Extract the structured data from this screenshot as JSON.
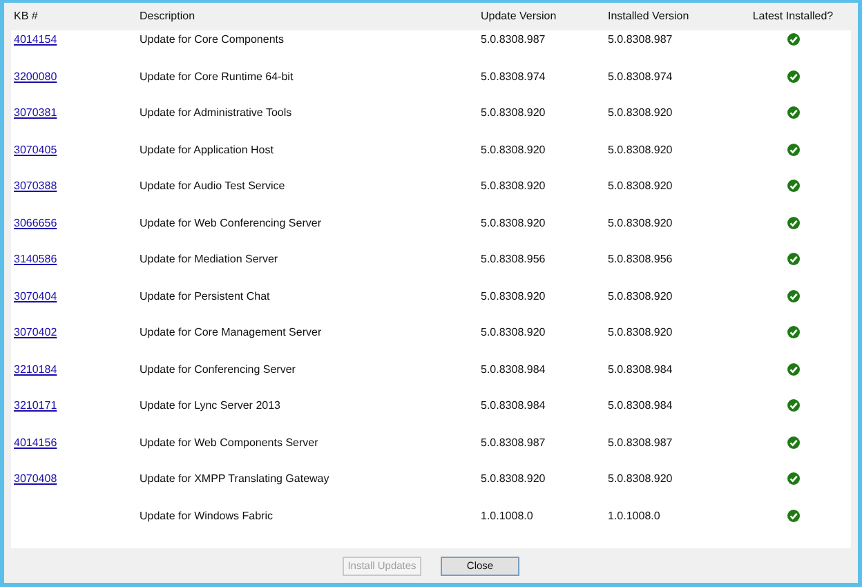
{
  "table": {
    "columns": [
      "KB #",
      "Description",
      "Update Version",
      "Installed Version",
      "Latest Installed?"
    ],
    "rows": [
      {
        "kb": "4014154",
        "description": "Update for Core Components",
        "update_version": "5.0.8308.987",
        "installed_version": "5.0.8308.987",
        "latest_installed": true
      },
      {
        "kb": "3200080",
        "description": "Update for Core Runtime 64-bit",
        "update_version": "5.0.8308.974",
        "installed_version": "5.0.8308.974",
        "latest_installed": true
      },
      {
        "kb": "3070381",
        "description": "Update for Administrative Tools",
        "update_version": "5.0.8308.920",
        "installed_version": "5.0.8308.920",
        "latest_installed": true
      },
      {
        "kb": "3070405",
        "description": "Update for Application Host",
        "update_version": "5.0.8308.920",
        "installed_version": "5.0.8308.920",
        "latest_installed": true
      },
      {
        "kb": "3070388",
        "description": "Update for Audio Test Service",
        "update_version": "5.0.8308.920",
        "installed_version": "5.0.8308.920",
        "latest_installed": true
      },
      {
        "kb": "3066656",
        "description": "Update for Web Conferencing Server",
        "update_version": "5.0.8308.920",
        "installed_version": "5.0.8308.920",
        "latest_installed": true
      },
      {
        "kb": "3140586",
        "description": "Update for Mediation Server",
        "update_version": "5.0.8308.956",
        "installed_version": "5.0.8308.956",
        "latest_installed": true
      },
      {
        "kb": "3070404",
        "description": "Update for Persistent Chat",
        "update_version": "5.0.8308.920",
        "installed_version": "5.0.8308.920",
        "latest_installed": true
      },
      {
        "kb": "3070402",
        "description": "Update for Core Management Server",
        "update_version": "5.0.8308.920",
        "installed_version": "5.0.8308.920",
        "latest_installed": true
      },
      {
        "kb": "3210184",
        "description": "Update for Conferencing Server",
        "update_version": "5.0.8308.984",
        "installed_version": "5.0.8308.984",
        "latest_installed": true
      },
      {
        "kb": "3210171",
        "description": "Update for Lync Server 2013",
        "update_version": "5.0.8308.984",
        "installed_version": "5.0.8308.984",
        "latest_installed": true
      },
      {
        "kb": "4014156",
        "description": "Update for Web Components Server",
        "update_version": "5.0.8308.987",
        "installed_version": "5.0.8308.987",
        "latest_installed": true
      },
      {
        "kb": "3070408",
        "description": "Update for XMPP Translating Gateway",
        "update_version": "5.0.8308.920",
        "installed_version": "5.0.8308.920",
        "latest_installed": true
      },
      {
        "description": "Update for Windows Fabric",
        "update_version": "1.0.1008.0",
        "installed_version": "1.0.1008.0",
        "latest_installed": true
      }
    ]
  },
  "buttons": [
    {
      "label": "Install Updates",
      "disabled": true
    },
    {
      "label": "Close",
      "disabled": false
    }
  ]
}
